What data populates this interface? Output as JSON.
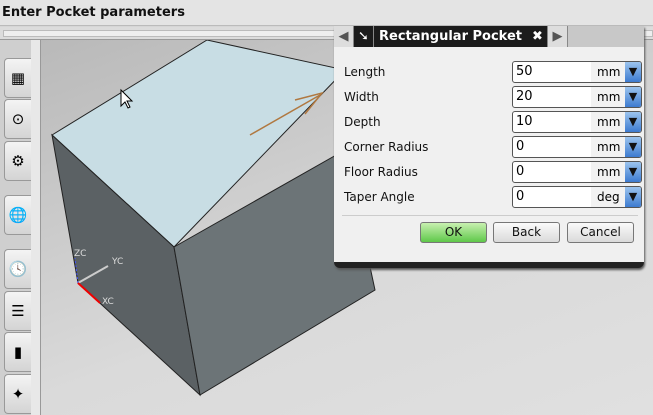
{
  "cue_line": "Enter Pocket parameters",
  "dialog": {
    "title": "Rectangular Pocket",
    "fields": [
      {
        "label": "Length",
        "value": "50",
        "unit": "mm"
      },
      {
        "label": "Width",
        "value": "20",
        "unit": "mm"
      },
      {
        "label": "Depth",
        "value": "10",
        "unit": "mm"
      },
      {
        "label": "Corner Radius",
        "value": "0",
        "unit": "mm"
      },
      {
        "label": "Floor Radius",
        "value": "0",
        "unit": "mm"
      },
      {
        "label": "Taper Angle",
        "value": "0",
        "unit": "deg"
      }
    ],
    "ok": "OK",
    "back": "Back",
    "cancel": "Cancel"
  },
  "axes": {
    "z": "ZC",
    "y": "YC",
    "x": "XC"
  }
}
